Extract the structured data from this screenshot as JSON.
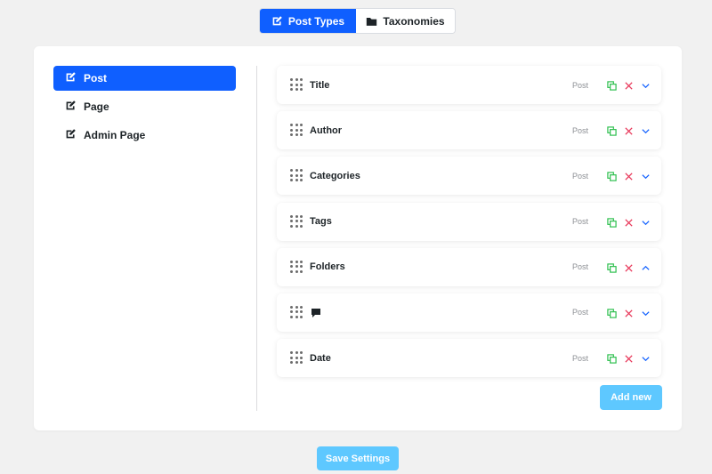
{
  "tabs": [
    {
      "label": "Post Types",
      "icon": "edit-icon",
      "active": true
    },
    {
      "label": "Taxonomies",
      "icon": "folder-icon",
      "active": false
    }
  ],
  "sidebar": {
    "items": [
      {
        "label": "Post",
        "icon": "edit-icon",
        "active": true
      },
      {
        "label": "Page",
        "icon": "edit-icon",
        "active": false
      },
      {
        "label": "Admin Page",
        "icon": "edit-icon",
        "active": false
      }
    ]
  },
  "fields": [
    {
      "label": "Title",
      "type": "Post",
      "expanded": false
    },
    {
      "label": "Author",
      "type": "Post",
      "expanded": false
    },
    {
      "label": "Categories",
      "type": "Post",
      "expanded": false
    },
    {
      "label": "Tags",
      "type": "Post",
      "expanded": false
    },
    {
      "label": "Folders",
      "type": "Post",
      "expanded": true
    },
    {
      "label": "",
      "icon": "comment-icon",
      "type": "Post",
      "expanded": false
    },
    {
      "label": "Date",
      "type": "Post",
      "expanded": false
    }
  ],
  "buttons": {
    "add_new": "Add new",
    "save_settings": "Save Settings"
  },
  "colors": {
    "accent": "#0f5fff",
    "button": "#5ec8ff",
    "duplicate": "#2dbf4e",
    "delete": "#e8395b",
    "toggle": "#0f5fff"
  }
}
